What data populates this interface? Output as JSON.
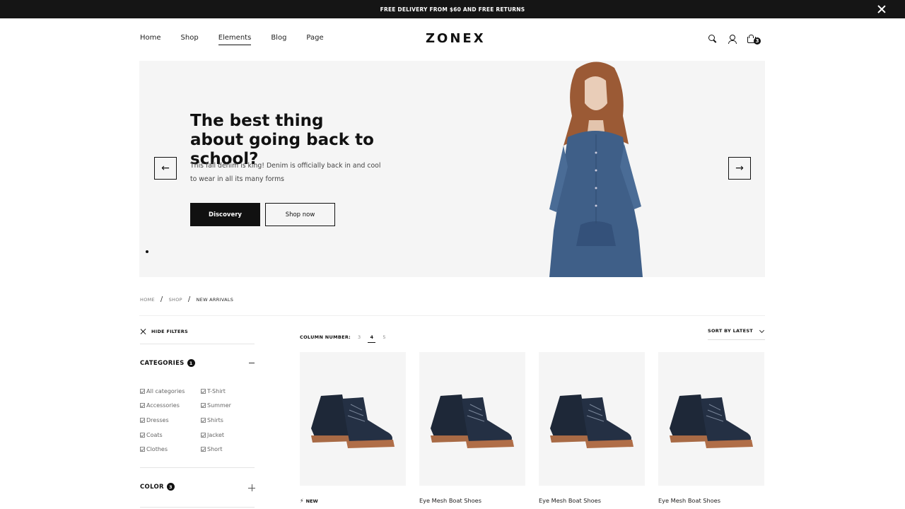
{
  "announcement": {
    "text": "FREE DELIVERY FROM $60 AND FREE RETURNS"
  },
  "nav": {
    "items": [
      {
        "label": "Home"
      },
      {
        "label": "Shop"
      },
      {
        "label": "Elements"
      },
      {
        "label": "Blog"
      },
      {
        "label": "Page"
      }
    ],
    "active": "Elements"
  },
  "brand": {
    "logo": "ZONEX"
  },
  "header_icons": [
    "search-icon",
    "user-icon",
    "cart-icon"
  ],
  "cart": {
    "count": "3"
  },
  "hero": {
    "title": "The best thing about going back to school?",
    "subtitle": "This fall denim is king! Denim is officially back in and cool to wear in all its many forms",
    "primary_button": "Discovery",
    "secondary_button": "Shop now",
    "prev_arrow": "←",
    "next_arrow": "→"
  },
  "breadcrumb": {
    "items": [
      "HOME",
      "SHOP",
      "NEW ARRIVALS"
    ],
    "separator": "/"
  },
  "filters": {
    "toggle_label": "HIDE FILTERS",
    "categories": {
      "title": "CATEGORIES",
      "badge": "1",
      "left": [
        "All categories",
        "Accessories",
        "Dresses",
        "Coats",
        "Clothes"
      ],
      "right": [
        "T-Shirt",
        "Summer",
        "Shirts",
        "Jacket",
        "Short"
      ]
    },
    "color": {
      "title": "COLOR",
      "badge": "3"
    }
  },
  "toolbar": {
    "column_label": "COLUMN NUMBER:",
    "columns": [
      "3",
      "4",
      "5"
    ],
    "active_column": "4",
    "sort_label": "SORT BY LATEST"
  },
  "products": [
    {
      "name": "",
      "tag": "NEW"
    },
    {
      "name": "Eye Mesh Boat Shoes"
    },
    {
      "name": "Eye Mesh Boat Shoes"
    },
    {
      "name": "Eye Mesh Boat Shoes"
    }
  ],
  "colors": {
    "brand_dark": "#111111",
    "hero_bg": "#f5f5f5",
    "denim": "#3f5f88"
  }
}
